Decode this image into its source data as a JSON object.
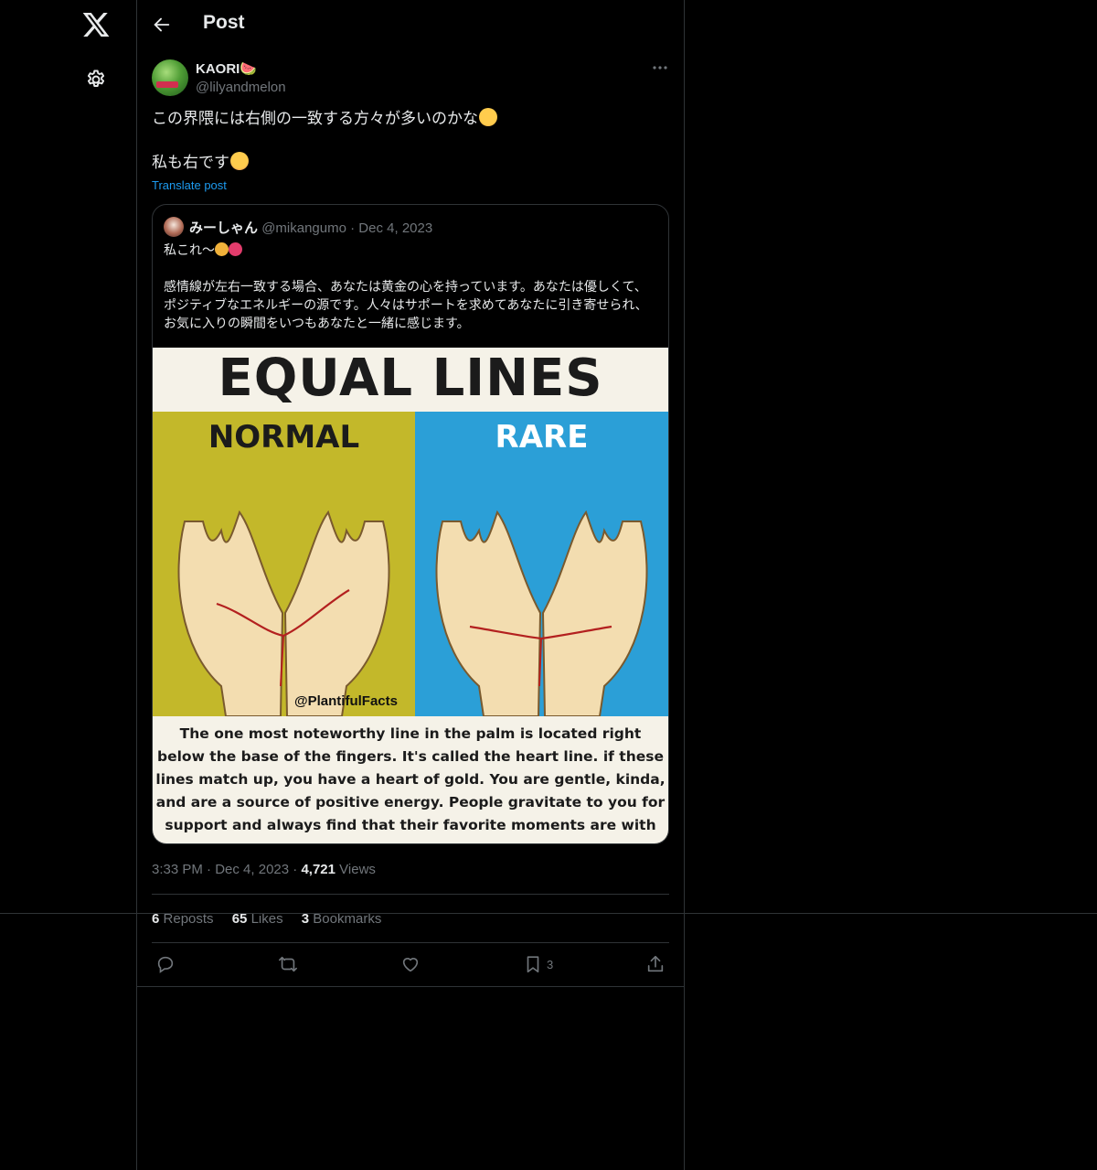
{
  "nav": {
    "logo": "x-logo-icon",
    "settings": "gear-icon"
  },
  "header": {
    "title": "Post"
  },
  "post": {
    "author_name": "KAORI🍉",
    "author_handle": "@lilyandmelon",
    "text_line1": "この界隈には右側の一致する方々が多いのかな",
    "text_line2": "私も右です",
    "translate": "Translate post",
    "time": "3:33 PM",
    "date": "Dec 4, 2023",
    "views_count": "4,721",
    "views_label": "Views",
    "reposts_count": "6",
    "reposts_label": "Reposts",
    "likes_count": "65",
    "likes_label": "Likes",
    "bookmarks_count": "3",
    "bookmarks_label": "Bookmarks",
    "bookmark_action_count": "3"
  },
  "quote": {
    "name": "みーしゃん",
    "handle": "@mikangumo",
    "dot": "·",
    "date": "Dec 4, 2023",
    "text_line1": "私これ〜",
    "text_body": "感情線が左右一致する場合、あなたは黄金の心を持っています。あなたは優しくて、ポジティブなエネルギーの源です。人々はサポートを求めてあなたに引き寄せられ、お気に入りの瞬間をいつもあなたと一緒に感じます。",
    "media": {
      "title": "EQUAL LINES",
      "left_label": "NORMAL",
      "right_label": "RARE",
      "watermark": "@PlantifulFacts",
      "caption": "The one most noteworthy line in the palm is located right below the base of the fingers.  It's called the heart line.  if these lines match up, you have a heart of gold.  You are gentle, kinda, and are a source of positive energy.  People gravitate to you for support and always find that their favorite moments are with you."
    }
  },
  "colors": {
    "background": "#000000",
    "border": "#2f3336",
    "muted": "#71767b",
    "link": "#1d9bf0",
    "text": "#e7e9ea"
  }
}
